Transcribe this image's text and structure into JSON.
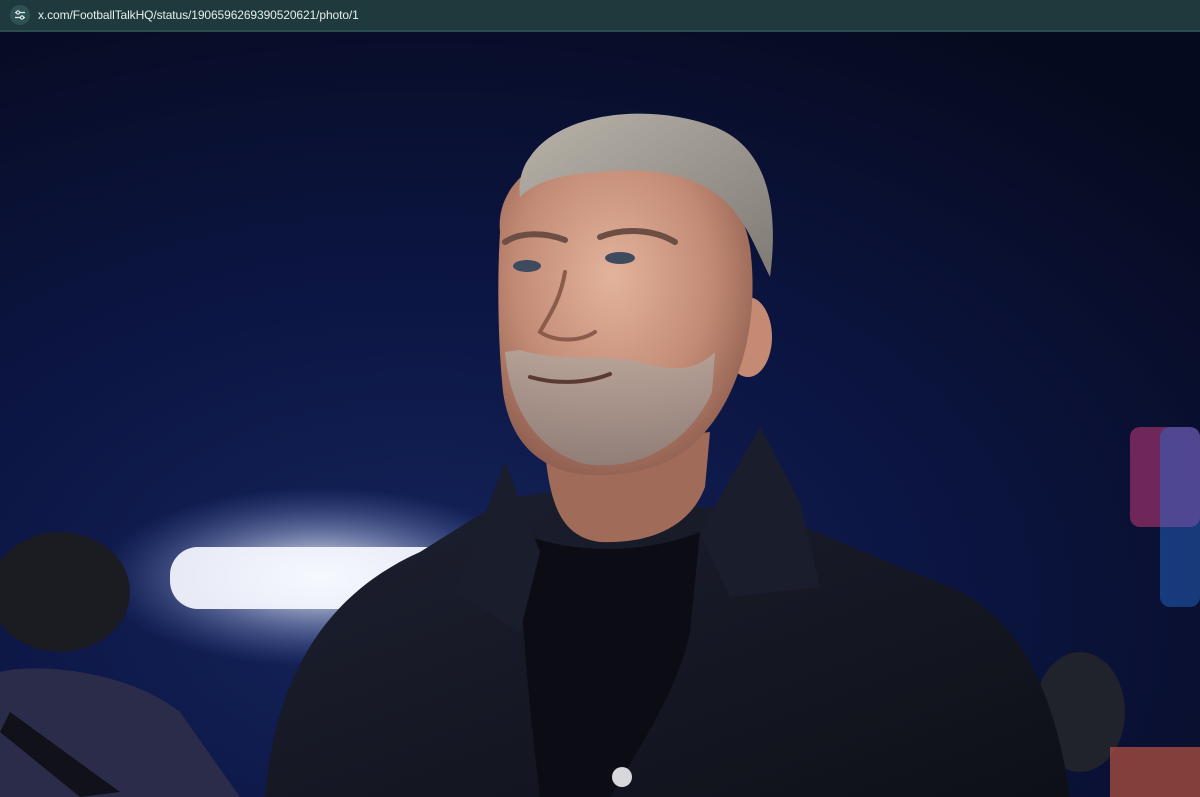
{
  "browser": {
    "url": "x.com/FootballTalkHQ/status/1906596269390520621/photo/1",
    "site_info_icon": "tune-icon"
  },
  "photo": {
    "subject": "portrait-photo",
    "colors": {
      "sky": "#0a1233",
      "floodlight": "#ffffff",
      "jacket": "#14161f"
    }
  }
}
